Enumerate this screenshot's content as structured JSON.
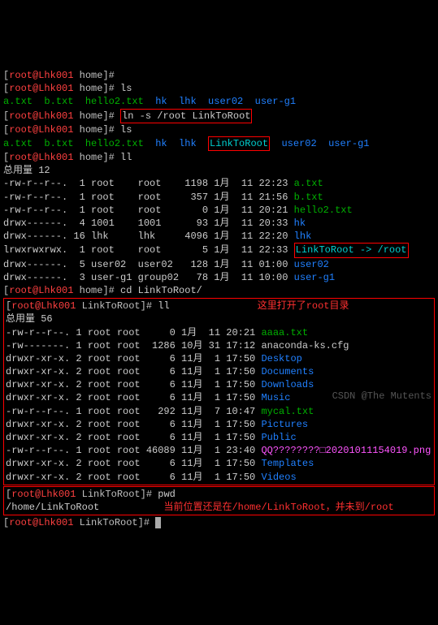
{
  "lines": {
    "p1_user": "root@Lhk001",
    "p1_path": "home",
    "p1_end": "]#",
    "l2_cmd": "ls",
    "l3_a": "a.txt  b.txt  hello2.txt  ",
    "l3_hk": "hk  lhk  user02  user-g1",
    "l4_cmd": "ln -s /root LinkToRoot",
    "l5_cmd": "ls",
    "l6_a": "a.txt  b.txt  hello2.txt  ",
    "l6_b": "hk  lhk  ",
    "l6_link": "LinkToRoot",
    "l6_c": "  user02  user-g1",
    "l7_cmd": "ll",
    "l8": "总用量 12",
    "f1": "-rw-r--r--.  1 root    root    1198 1月  11 22:23 ",
    "f1n": "a.txt",
    "f2": "-rw-r--r--.  1 root    root     357 1月  11 21:56 ",
    "f2n": "b.txt",
    "f3": "-rw-r--r--.  1 root    root       0 1月  11 20:21 ",
    "f3n": "hello2.txt",
    "f4": "drwx------.  4 1001    1001      93 1月  11 20:33 ",
    "f4n": "hk",
    "f5": "drwx------. 16 lhk     lhk     4096 1月  11 22:20 ",
    "f5n": "lhk",
    "f6": "lrwxrwxrwx.  1 root    root       5 1月  11 22:33 ",
    "f6n": "LinkToRoot -> /root",
    "f7": "drwx------.  5 user02  user02   128 1月  11 01:00 ",
    "f7n": "user02",
    "f8": "drwx------.  3 user-g1 group02   78 1月  11 10:00 ",
    "f8n": "user-g1",
    "cd_cmd": "cd LinkToRoot/",
    "p2_path": "LinkToRoot",
    "ll2_cmd": "ll",
    "anno1": "这里打开了root目录",
    "l_total2": "总用量 56",
    "r1": "-rw-r--r--. 1 root root     0 1月  11 20:21 ",
    "r1n": "aaaa.txt",
    "r2": "-rw-------. 1 root root  1286 10月 31 17:12 ",
    "r2n": "anaconda-ks.cfg",
    "r3": "drwxr-xr-x. 2 root root     6 11月  1 17:50 ",
    "r3n": "Desktop",
    "r4": "drwxr-xr-x. 2 root root     6 11月  1 17:50 ",
    "r4n": "Documents",
    "r5": "drwxr-xr-x. 2 root root     6 11月  1 17:50 ",
    "r5n": "Downloads",
    "r6": "drwxr-xr-x. 2 root root     6 11月  1 17:50 ",
    "r6n": "Music",
    "r7": "-rw-r--r--. 1 root root   292 11月  7 10:47 ",
    "r7n": "mycal.txt",
    "r8": "drwxr-xr-x. 2 root root     6 11月  1 17:50 ",
    "r8n": "Pictures",
    "r9": "drwxr-xr-x. 2 root root     6 11月  1 17:50 ",
    "r9n": "Public",
    "r10": "-rw-r--r--. 1 root root 46089 11月  1 23:40 ",
    "r10n": "QQ????????□20201011154019.png",
    "r11": "drwxr-xr-x. 2 root root     6 11月  1 17:50 ",
    "r11n": "Templates",
    "r12": "drwxr-xr-x. 2 root root     6 11月  1 17:50 ",
    "r12n": "Videos",
    "pwd_cmd": "pwd",
    "pwd_out": "/home/LinkToRoot",
    "anno2": "当前位置还是在/home/LinkToRoot，并未到/root",
    "watermark": "CSDN @The Mutents"
  }
}
